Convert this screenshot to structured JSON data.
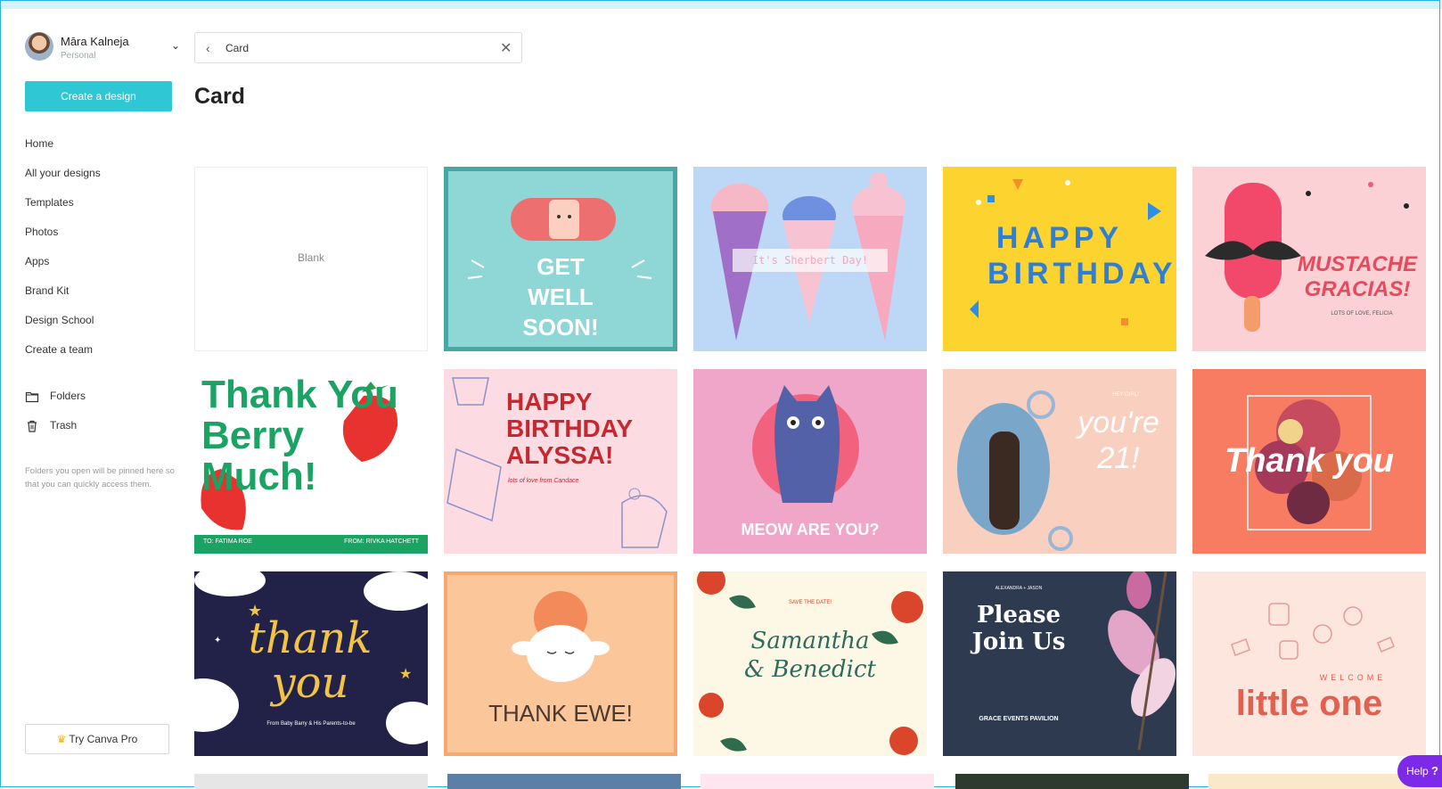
{
  "user": {
    "name": "Māra Kalneja",
    "plan": "Personal"
  },
  "sidebar": {
    "create_label": "Create a design",
    "nav": [
      "Home",
      "All your designs",
      "Templates",
      "Photos",
      "Apps",
      "Brand Kit",
      "Design School",
      "Create a team"
    ],
    "folders_label": "Folders",
    "trash_label": "Trash",
    "note": "Folders you open will be pinned here so that you can quickly access them.",
    "pro_label": "Try Canva Pro"
  },
  "search": {
    "query": "Card"
  },
  "page_title": "Card",
  "templates": [
    {
      "label": "Blank"
    },
    {
      "label": "GET WELL SOON!",
      "bg": "#8ed7d6"
    },
    {
      "label": "It's Sherbert Day!",
      "bg": "#bcd8f6"
    },
    {
      "label": "HAPPY BIRTHDAY",
      "bg": "#fdd42f"
    },
    {
      "label": "MUSTACHE GRACIAS!",
      "sub": "LOTS OF LOVE, FELICIA",
      "bg": "#fbd1d6"
    },
    {
      "label": "Thank You Berry Much!",
      "sub_left": "TO: FATIMA ROE",
      "sub_right": "FROM: RIVKA HATCHETT",
      "bg": "#ffffff"
    },
    {
      "label": "HAPPY BIRTHDAY ALYSSA!",
      "sub": "lots of love from Candace",
      "bg": "#fcdbe2"
    },
    {
      "label": "MEOW ARE YOU?",
      "bg": "#f0a6c9"
    },
    {
      "label": "you're 21!",
      "sub": "HEY GIRL!",
      "bg": "#f9cfbf"
    },
    {
      "label": "Thank you",
      "bg": "#f87c62"
    },
    {
      "label": "thank you",
      "sub": "From Baby Barry & His Parents-to-be",
      "bg": "#222248"
    },
    {
      "label": "THANK EWE!",
      "bg": "#fbc69a"
    },
    {
      "label": "Samantha & Benedict",
      "sub": "SAVE THE DATE!",
      "bg": "#fdf8e6"
    },
    {
      "label": "Please Join Us",
      "sub": "GRACE EVENTS PAVILION",
      "sub2": "ALEXANDRA + JASON",
      "bg": "#2e3a4f"
    },
    {
      "label": "little one",
      "sub": "WELCOME",
      "bg": "#fde6de"
    }
  ],
  "help_label": "Help",
  "help_mark": "?"
}
